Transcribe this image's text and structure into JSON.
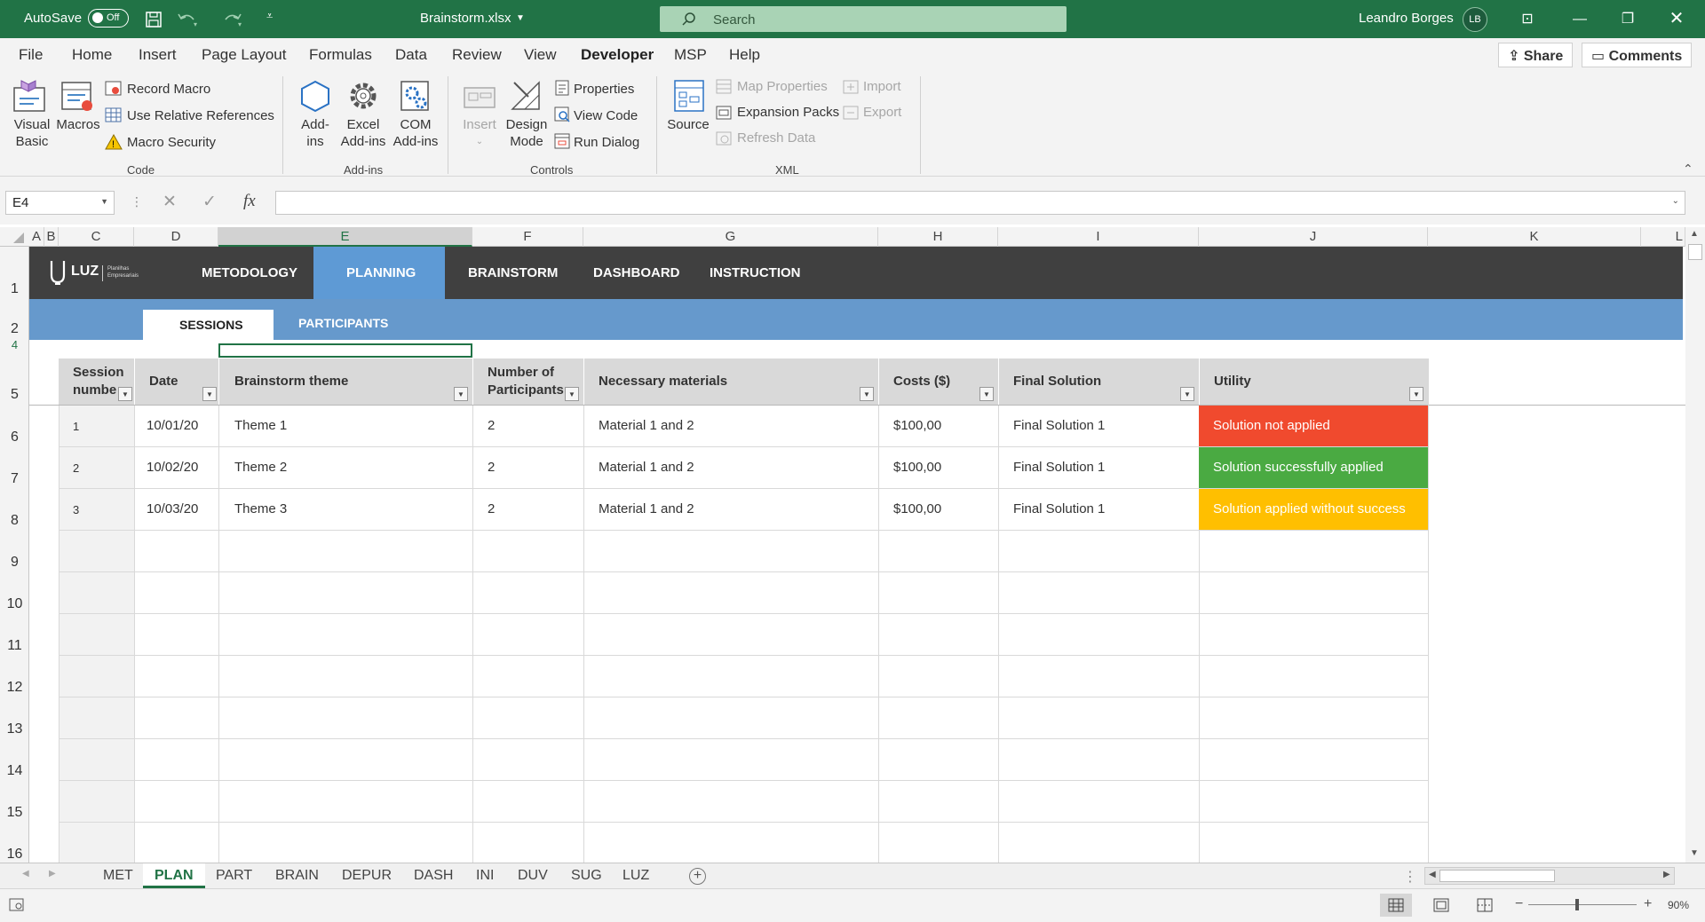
{
  "titlebar": {
    "autosave_label": "AutoSave",
    "autosave_state": "Off",
    "filename": "Brainstorm.xlsx",
    "search_placeholder": "Search",
    "user_name": "Leandro Borges",
    "user_initials": "LB"
  },
  "ribbon_tabs": [
    "File",
    "Home",
    "Insert",
    "Page Layout",
    "Formulas",
    "Data",
    "Review",
    "View",
    "Developer",
    "MSP",
    "Help"
  ],
  "active_tab": "Developer",
  "header_buttons": {
    "share": "Share",
    "comments": "Comments"
  },
  "ribbon": {
    "code": {
      "group_label": "Code",
      "visual_basic_1": "Visual",
      "visual_basic_2": "Basic",
      "macros": "Macros",
      "record_macro": "Record Macro",
      "relative_refs": "Use Relative References",
      "macro_security": "Macro Security"
    },
    "addins": {
      "group_label": "Add-ins",
      "addins_1": "Add-",
      "addins_2": "ins",
      "excel_addins_1": "Excel",
      "excel_addins_2": "Add-ins",
      "com_addins_1": "COM",
      "com_addins_2": "Add-ins"
    },
    "controls": {
      "group_label": "Controls",
      "insert": "Insert",
      "design_mode_1": "Design",
      "design_mode_2": "Mode",
      "properties": "Properties",
      "view_code": "View Code",
      "run_dialog": "Run Dialog"
    },
    "xml": {
      "group_label": "XML",
      "source": "Source",
      "map_properties": "Map Properties",
      "expansion_packs": "Expansion Packs",
      "refresh_data": "Refresh Data",
      "import": "Import",
      "export": "Export"
    }
  },
  "formula_bar": {
    "name_box": "E4",
    "fx": "fx",
    "formula": ""
  },
  "columns": [
    "A",
    "B",
    "C",
    "D",
    "E",
    "F",
    "G",
    "H",
    "I",
    "J",
    "K",
    "L"
  ],
  "rows": [
    "1",
    "2",
    "4",
    "5",
    "6",
    "7",
    "8",
    "9",
    "10",
    "11",
    "12",
    "13",
    "14",
    "15",
    "16"
  ],
  "sheet_nav": {
    "logo": "LUZ",
    "logo_sub_1": "Planilhas",
    "logo_sub_2": "Empresariais",
    "items": [
      "METODOLOGY",
      "PLANNING",
      "BRAINSTORM",
      "DASHBOARD",
      "INSTRUCTION"
    ],
    "active": "PLANNING",
    "sub_items": [
      "SESSIONS",
      "PARTICIPANTS"
    ],
    "sub_active": "SESSIONS"
  },
  "table": {
    "headers": [
      "Session number",
      "Date",
      "Brainstorm theme",
      "Number of Participants",
      "Necessary materials",
      "Costs ($)",
      "Final Solution",
      "Utility"
    ],
    "header_lines": [
      [
        "Session",
        "numbe"
      ],
      [
        "Date"
      ],
      [
        "Brainstorm theme"
      ],
      [
        "Number of",
        "Participants"
      ],
      [
        "Necessary materials"
      ],
      [
        "Costs ($)"
      ],
      [
        "Final Solution"
      ],
      [
        "Utility"
      ]
    ],
    "rows": [
      {
        "session": "1",
        "date": "10/01/20",
        "theme": "Theme 1",
        "participants": "2",
        "materials": "Material 1 and 2",
        "costs": "$100,00",
        "final": "Final Solution 1",
        "utility": "Solution not applied",
        "utility_color": "#f04a2e"
      },
      {
        "session": "2",
        "date": "10/02/20",
        "theme": "Theme 2",
        "participants": "2",
        "materials": "Material 1 and 2",
        "costs": "$100,00",
        "final": "Final Solution 1",
        "utility": "Solution successfully applied",
        "utility_color": "#4aaa42"
      },
      {
        "session": "3",
        "date": "10/03/20",
        "theme": "Theme 3",
        "participants": "2",
        "materials": "Material 1 and 2",
        "costs": "$100,00",
        "final": "Final Solution 1",
        "utility": "Solution applied without success",
        "utility_color": "#ffbf00"
      }
    ]
  },
  "sheet_tabs": [
    "MET",
    "PLAN",
    "PART",
    "BRAIN",
    "DEPUR",
    "DASH",
    "INI",
    "DUV",
    "SUG",
    "LUZ"
  ],
  "active_sheet": "PLAN",
  "status": {
    "zoom": "90%"
  },
  "colors": {
    "excel_green": "#217346",
    "nav_dark": "#404040",
    "nav_blue": "#6699cc",
    "nav_active": "#5e9ad5"
  }
}
